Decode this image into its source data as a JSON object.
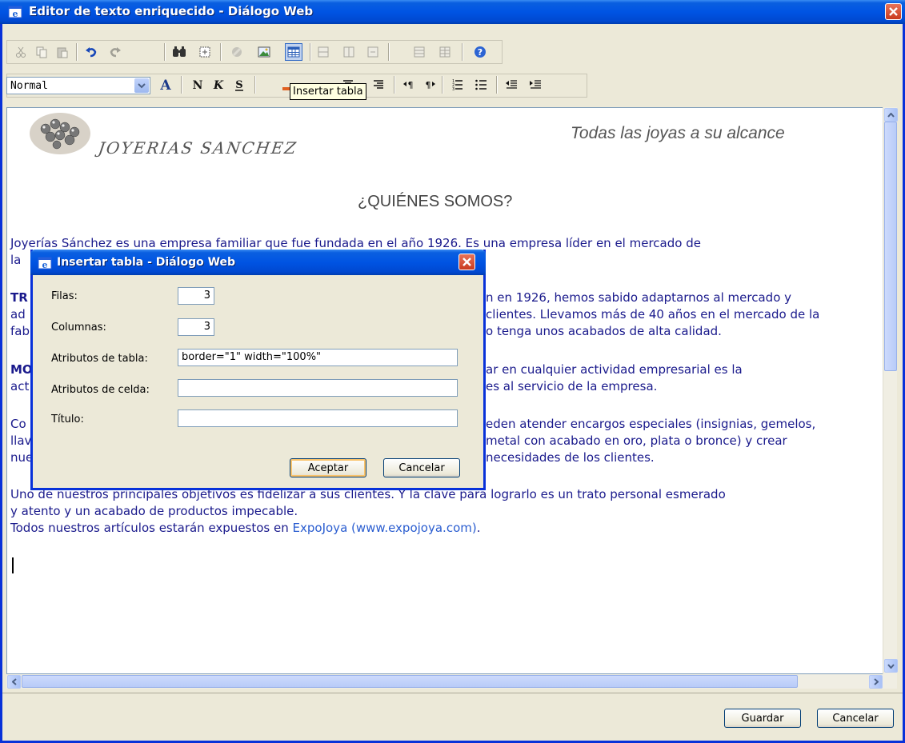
{
  "window": {
    "title": "Editor de texto enriquecido - Diálogo Web"
  },
  "toolbar": {
    "format_select_value": "Normal",
    "tooltip": "Insertar tabla"
  },
  "content": {
    "brand": "JOYERIAS SANCHEZ",
    "slogan": "Todas las joyas a su alcance",
    "heading": "¿QUIÉNES SOMOS?",
    "lines": [
      "Joyerías Sánchez es una empresa familiar que fue fundada en el año 1926. Es una empresa líder en el mercado de",
      "la",
      "TR",
      "ad",
      "fab",
      "MO",
      "act",
      "Co",
      "llav",
      "nue",
      "Uno de nuestros principales objetivos es fidelizar a sus clientes. Y la clave para lograrlo es un trato personal esmerado",
      "y atento y un acabado de productos impecable.",
      "Todos nuestros artículos estarán expuestos en"
    ],
    "right_lines": [
      "n en 1926, hemos sabido adaptarnos al mercado y",
      "clientes. Llevamos más de 40 años en el mercado de la",
      "o tenga unos acabados de alta calidad.",
      "ar en cualquier actividad empresarial es la",
      "es al servicio de la empresa.",
      "eden atender encargos especiales (insignias, gemelos,",
      "metal con acabado en oro, plata o bronce) y crear",
      "necesidades de los clientes."
    ],
    "link_name": "ExpoJoya",
    "link_url": "(www.expojoya.com)",
    "link_end": "."
  },
  "bottom": {
    "save": "Guardar",
    "cancel": "Cancelar"
  },
  "dialog": {
    "title": "Insertar tabla - Diálogo Web",
    "rows_label": "Filas:",
    "rows_value": "3",
    "cols_label": "Columnas:",
    "cols_value": "3",
    "table_attr_label": "Atributos de tabla:",
    "table_attr_value": "border=\"1\" width=\"100%\"",
    "cell_attr_label": "Atributos de celda:",
    "cell_attr_value": "",
    "title_label": "Título:",
    "title_value": "",
    "ok": "Aceptar",
    "cancel": "Cancelar"
  },
  "colors": {
    "titlebar": "#0054e3",
    "text": "#1a1a8c",
    "link": "#2a5dd0",
    "close": "#c93a1e"
  }
}
